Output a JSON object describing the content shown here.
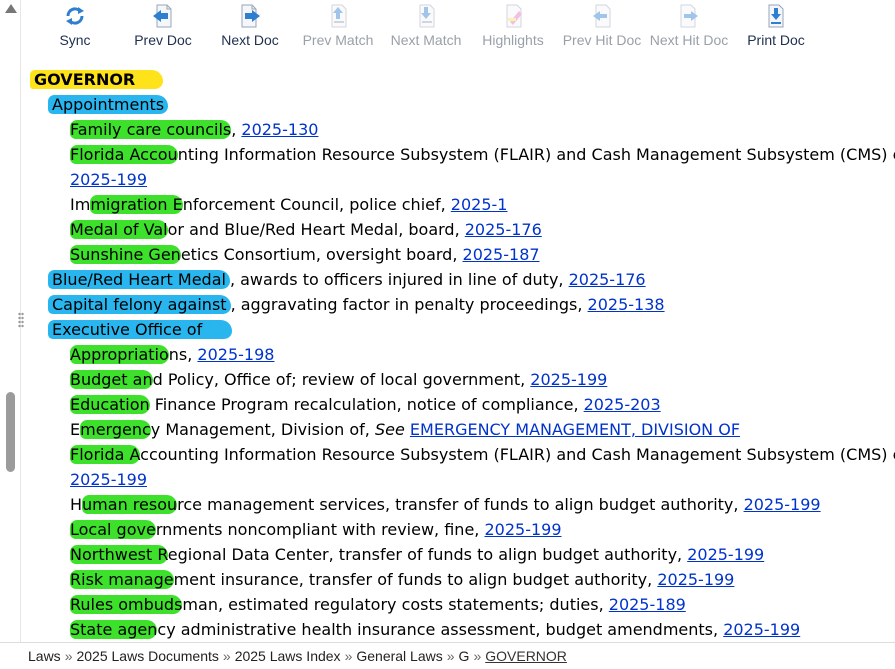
{
  "toolbar": {
    "sync": "Sync",
    "prev_doc": "Prev Doc",
    "next_doc": "Next Doc",
    "prev_match": "Prev Match",
    "next_match": "Next Match",
    "highlights": "Highlights",
    "prev_hit_doc": "Prev Hit Doc",
    "next_hit_doc": "Next Hit Doc",
    "print_doc": "Print Doc"
  },
  "colors": {
    "highlight_yellow": "#ffe31a",
    "highlight_blue": "#29b6ef",
    "highlight_green": "#3de02a",
    "link": "#0033cc"
  },
  "index": {
    "heading": "GOVERNOR",
    "appointments": {
      "label": "Appointments",
      "items": [
        {
          "hl": "Family care councils",
          "rest": ", ",
          "link": "2025-130"
        },
        {
          "hl": "Florida Accou",
          "rest": "nting Information Resource Subsystem (FLAIR) and Cash Management Subsystem (CMS) componen",
          "link": ""
        },
        {
          "hl": "",
          "rest": "",
          "link": "2025-199"
        },
        {
          "pre": "Im",
          "hl": "migration E",
          "rest": "nforcement Council, police chief, ",
          "link": "2025-1"
        },
        {
          "hl": "Medal of Val",
          "rest": "or and Blue/Red Heart Medal, board, ",
          "link": "2025-176"
        },
        {
          "hl": "Sunshine Gen",
          "rest": "etics Consortium, oversight board, ",
          "link": "2025-187"
        }
      ]
    },
    "blue_red": {
      "hl": "Blue/Red Heart Medal",
      "rest": ", awards to officers injured in line of duty, ",
      "link": "2025-176"
    },
    "capital": {
      "hl": "Capital felony against",
      "rest": ", aggravating factor in penalty proceedings, ",
      "link": "2025-138"
    },
    "exec_office": {
      "label": "Executive Office of",
      "items": [
        {
          "hl": "Appropriatio",
          "rest": "ns, ",
          "link": "2025-198"
        },
        {
          "hl": "Budget an",
          "rest": "d Policy, Office of; review of local government, ",
          "link": "2025-199"
        },
        {
          "hl": "Education",
          "rest": " Finance Program recalculation, notice of compliance, ",
          "link": "2025-203"
        },
        {
          "pre": "E",
          "hl": "mergenc",
          "rest": "y Management, Division of, ",
          "see": "See",
          "link": "EMERGENCY MANAGEMENT, DIVISION OF"
        },
        {
          "hl": "Florida A",
          "rest": "ccounting Information Resource Subsystem (FLAIR) and Cash Management Subsystem (CMS) componen",
          "link": ""
        },
        {
          "hl": "",
          "rest": "",
          "link": "2025-199"
        },
        {
          "pre": "H",
          "hl": "uman resou",
          "rest": "rce management services, transfer of funds to align budget authority, ",
          "link": "2025-199"
        },
        {
          "hl": "Local gove",
          "rest": "rnments noncompliant with review, fine, ",
          "link": "2025-199"
        },
        {
          "hl": "Northwest R",
          "rest": "egional Data Center, transfer of funds to align budget authority, ",
          "link": "2025-199"
        },
        {
          "hl": "Risk manage",
          "rest": "ment insurance, transfer of funds to align budget authority, ",
          "link": "2025-199"
        },
        {
          "hl": "Rules ombuds",
          "rest": "man, estimated regulatory costs statements; duties, ",
          "link": "2025-189"
        },
        {
          "hl": "State agen",
          "rest": "cy administrative health insurance assessment, budget amendments, ",
          "link": "2025-199"
        }
      ]
    }
  },
  "breadcrumb": {
    "items": [
      "Laws",
      "2025 Laws Documents",
      "2025 Laws Index",
      "General Laws",
      "G"
    ],
    "separator": "»",
    "current": "GOVERNOR"
  }
}
